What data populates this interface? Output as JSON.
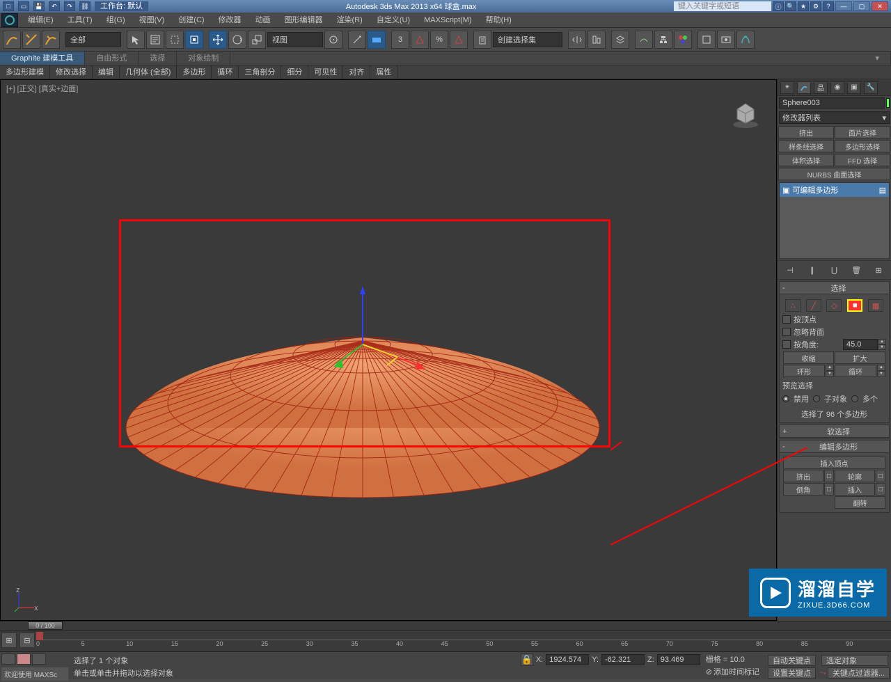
{
  "title_bar": {
    "workspace_label": "工作台: 默认",
    "app_title": "Autodesk 3ds Max  2013 x64     球盒.max",
    "search_placeholder": "键入关键字或短语"
  },
  "menubar": [
    "编辑(E)",
    "工具(T)",
    "组(G)",
    "视图(V)",
    "创建(C)",
    "修改器",
    "动画",
    "图形编辑器",
    "渲染(R)",
    "自定义(U)",
    "MAXScript(M)",
    "帮助(H)"
  ],
  "toolbar": {
    "filter_dropdown": "全部",
    "view_dropdown": "视图",
    "named_set": "创建选择集"
  },
  "ribbon_tabs": [
    "Graphite 建模工具",
    "自由形式",
    "选择",
    "对象绘制"
  ],
  "ribbon_subs": [
    "多边形建模",
    "修改选择",
    "编辑",
    "几何体 (全部)",
    "多边形",
    "循环",
    "三角剖分",
    "细分",
    "可见性",
    "对齐",
    "属性"
  ],
  "viewport_label": "[+] [正交] [真实+边面]",
  "right_panel": {
    "object_name": "Sphere003",
    "modifier_list": "修改器列表",
    "modifier_btns": [
      "挤出",
      "面片选择",
      "样条线选择",
      "多边形选择",
      "体积选择",
      "FFD 选择",
      "NURBS 曲面选择"
    ],
    "stack_item": "可编辑多边形",
    "rollouts": {
      "selection": {
        "title": "选择",
        "by_vertex": "按顶点",
        "ignore_back": "忽略背面",
        "by_angle": "按角度:",
        "angle_value": "45.0",
        "shrink": "收缩",
        "grow": "扩大",
        "ring": "环形",
        "loop": "循环",
        "preview": "预览选择",
        "disable": "禁用",
        "subobj": "子对象",
        "multi": "多个",
        "count_msg": "选择了 96 个多边形"
      },
      "soft": {
        "title": "软选择"
      },
      "edit_poly": {
        "title": "编辑多边形",
        "insert_vertex": "插入顶点",
        "extrude": "挤出",
        "outline": "轮廓",
        "bevel": "倒角",
        "inset": "插入",
        "flip": "翻转"
      }
    }
  },
  "timeline": {
    "frame": "0 / 100"
  },
  "trackbar_ticks": [
    "0",
    "5",
    "10",
    "15",
    "20",
    "25",
    "30",
    "35",
    "40",
    "45",
    "50",
    "55",
    "60",
    "65",
    "70",
    "75",
    "80",
    "85",
    "90"
  ],
  "statusbar": {
    "welcome": "欢迎使用  MAXSc",
    "selected": "选择了 1 个对象",
    "hint": "单击或单击并拖动以选择对象",
    "x": "1924.574",
    "y": "-62.321",
    "z": "93.469",
    "grid": "栅格 = 10.0",
    "auto_key": "自动关键点",
    "sel_set": "选定对象",
    "add_time": "添加时间标记",
    "set_key": "设置关键点",
    "key_filter": "关键点过滤器..."
  },
  "watermark": {
    "cn": "溜溜自学",
    "en": "ZIXUE.3D66.COM"
  }
}
